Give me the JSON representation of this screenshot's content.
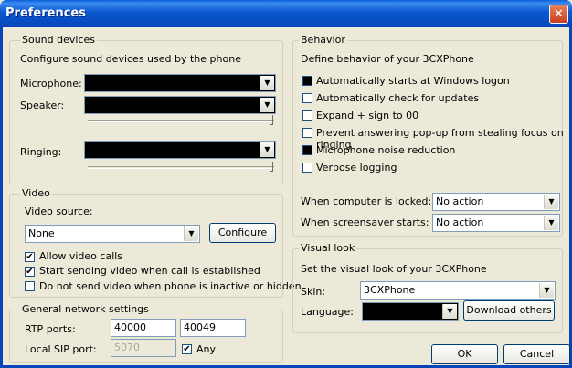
{
  "window": {
    "title": "Preferences"
  },
  "sound": {
    "legend": "Sound devices",
    "description": "Configure sound devices used by the phone",
    "microphone_label": "Microphone:",
    "speaker_label": "Speaker:",
    "ringing_label": "Ringing:"
  },
  "video": {
    "legend": "Video",
    "source_label": "Video source:",
    "source_value": "None",
    "configure_label": "Configure",
    "checkboxes": [
      {
        "label": "Allow video calls",
        "checked": true
      },
      {
        "label": "Start sending video when call is established",
        "checked": true
      },
      {
        "label": "Do not send video when phone is inactive or hidden",
        "checked": false
      }
    ]
  },
  "network": {
    "legend": "General network settings",
    "rtp_label": "RTP ports:",
    "rtp_from": "40000",
    "rtp_to": "40049",
    "sip_label": "Local SIP port:",
    "sip_value": "5070",
    "any_label": "Any",
    "any_checked": true
  },
  "behavior": {
    "legend": "Behavior",
    "description": "Define behavior of your 3CXPhone",
    "options": [
      {
        "label": "Automatically starts at Windows logon",
        "state": "filled"
      },
      {
        "label": "Automatically check for updates",
        "state": "unchecked"
      },
      {
        "label": "Expand + sign to 00",
        "state": "unchecked"
      },
      {
        "label": "Prevent answering pop-up from stealing focus on ringing",
        "state": "unchecked"
      },
      {
        "label": "Microphone noise reduction",
        "state": "filled"
      },
      {
        "label": "Verbose logging",
        "state": "unchecked"
      }
    ],
    "locked_label": "When computer is locked:",
    "locked_value": "No action",
    "screensaver_label": "When screensaver starts:",
    "screensaver_value": "No action"
  },
  "visual": {
    "legend": "Visual look",
    "description": "Set the visual look of your 3CXPhone",
    "skin_label": "Skin:",
    "skin_value": "3CXPhone",
    "language_label": "Language:",
    "download_label": "Download others"
  },
  "footer": {
    "ok_label": "OK",
    "cancel_label": "Cancel"
  }
}
